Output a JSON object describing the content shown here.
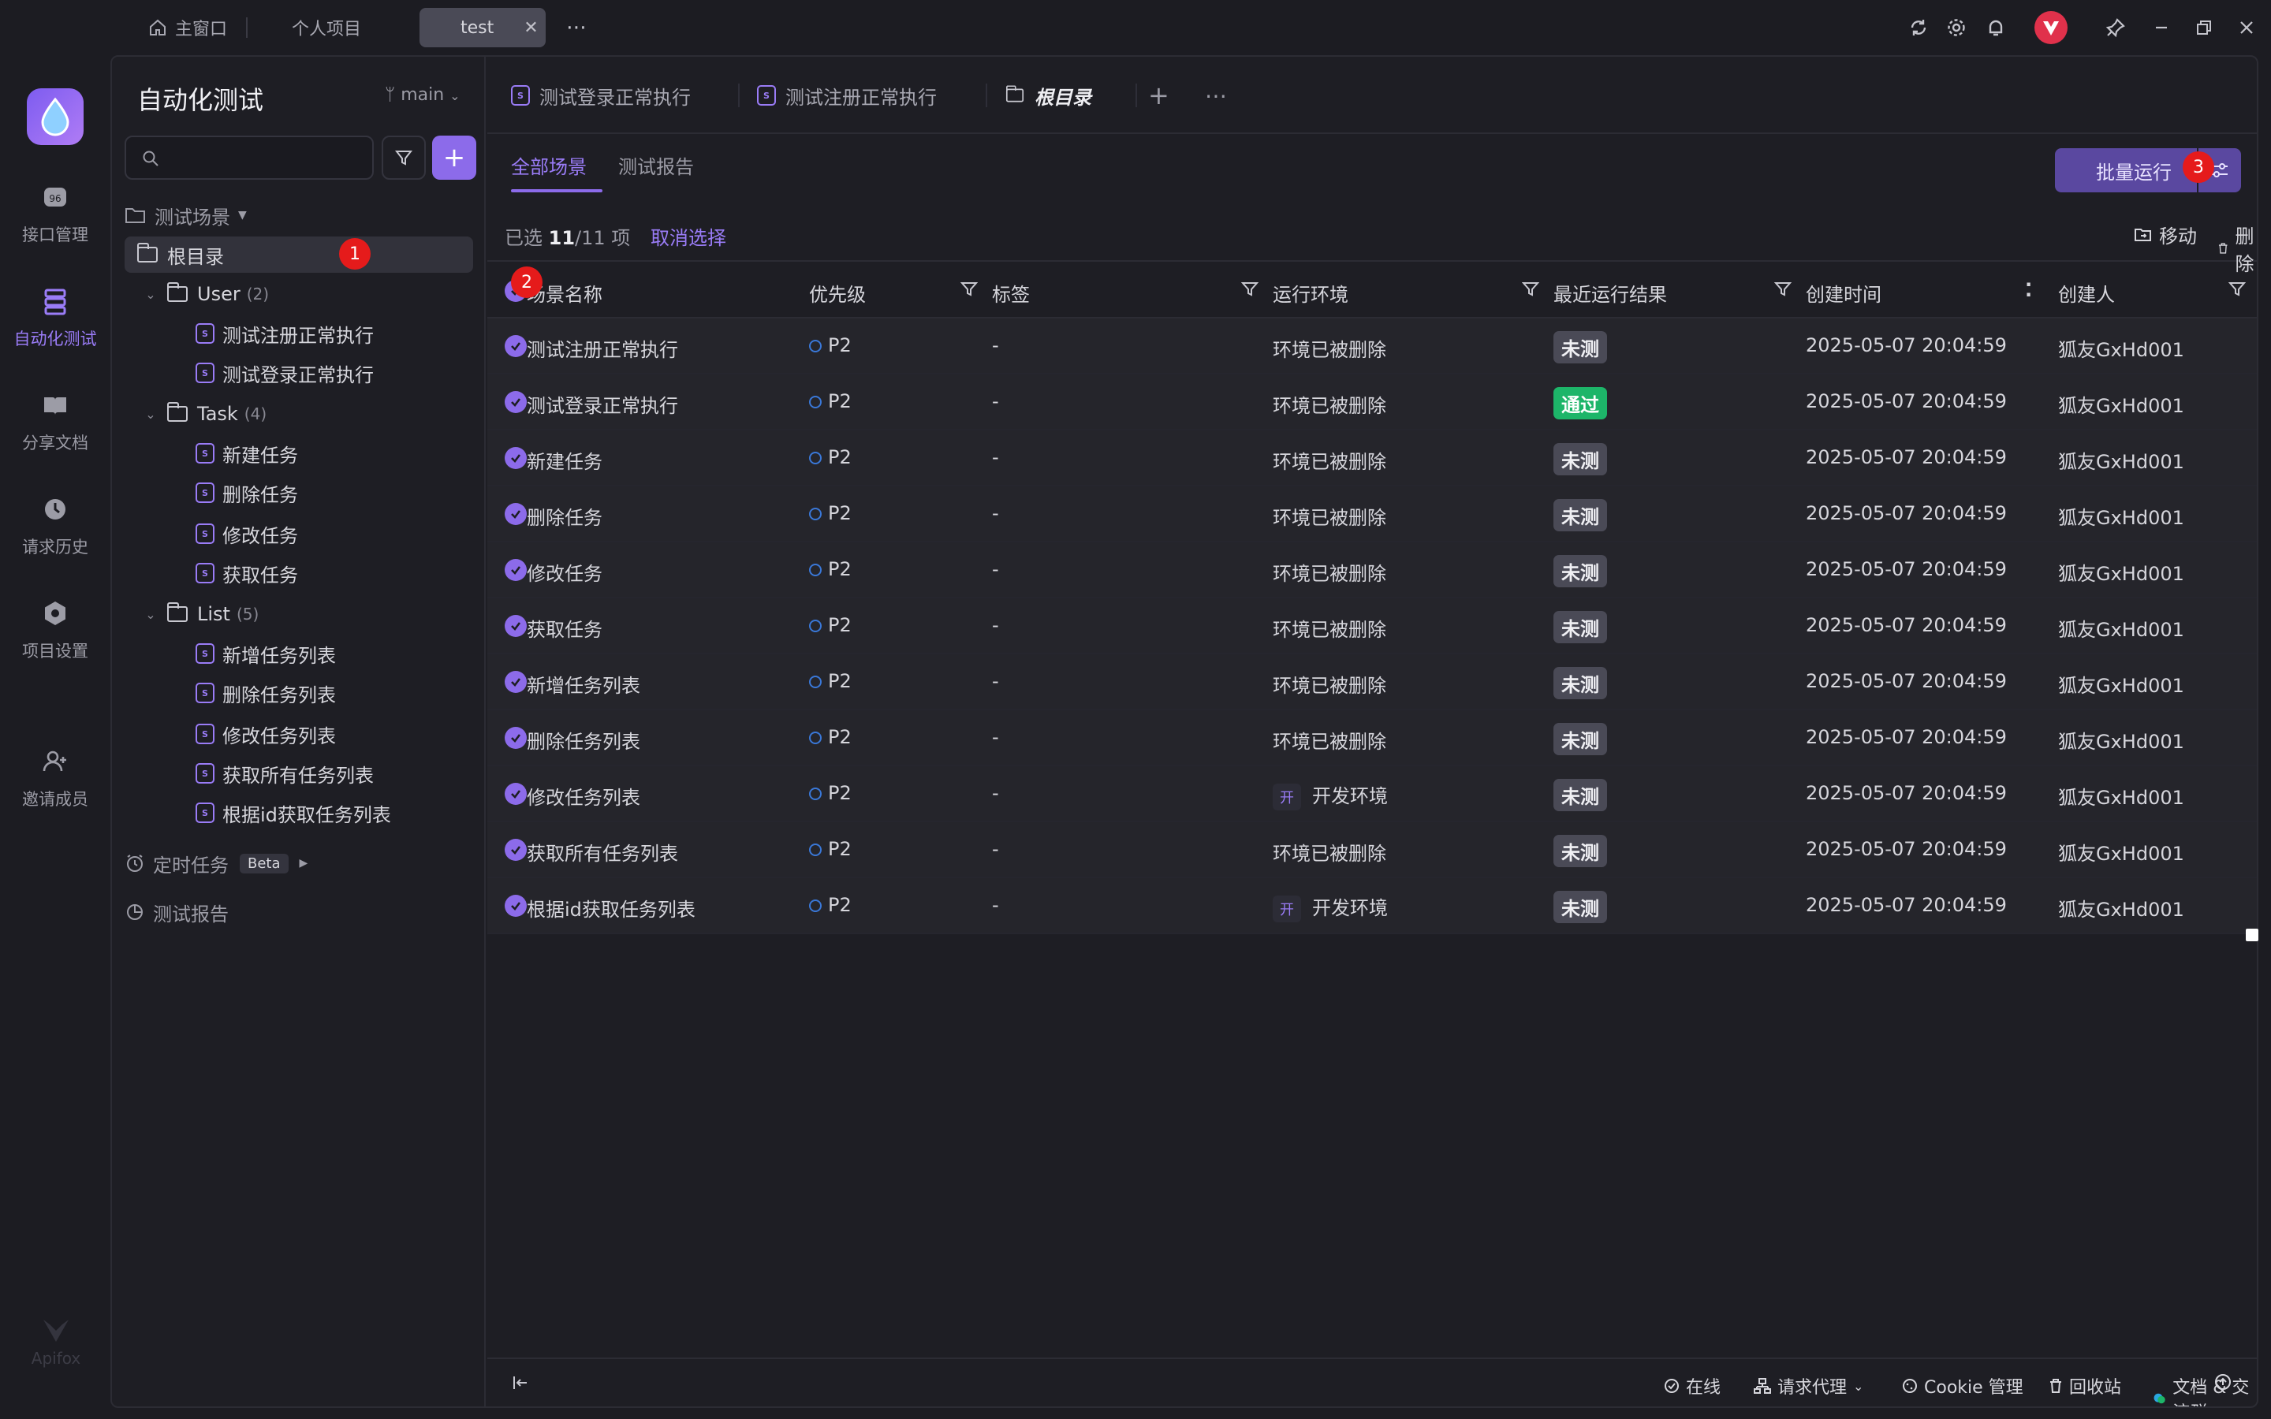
{
  "window": {
    "tabs": [
      {
        "label": "主窗口"
      },
      {
        "label": "个人项目"
      },
      {
        "label": "test"
      }
    ]
  },
  "rail": {
    "items": [
      {
        "label": "接口管理"
      },
      {
        "label": "自动化测试"
      },
      {
        "label": "分享文档"
      },
      {
        "label": "请求历史"
      },
      {
        "label": "项目设置"
      },
      {
        "label": "邀请成员"
      }
    ],
    "footer": "Apifox"
  },
  "sidebar": {
    "title": "自动化测试",
    "branch": "main",
    "section_label": "测试场景",
    "tree": [
      {
        "label": "根目录",
        "count": ""
      },
      {
        "label": "User",
        "count": "(2)"
      },
      {
        "label": "测试注册正常执行"
      },
      {
        "label": "测试登录正常执行"
      },
      {
        "label": "Task",
        "count": "(4)"
      },
      {
        "label": "新建任务"
      },
      {
        "label": "删除任务"
      },
      {
        "label": "修改任务"
      },
      {
        "label": "获取任务"
      },
      {
        "label": "List",
        "count": "(5)"
      },
      {
        "label": "新增任务列表"
      },
      {
        "label": "删除任务列表"
      },
      {
        "label": "修改任务列表"
      },
      {
        "label": "获取所有任务列表"
      },
      {
        "label": "根据id获取任务列表"
      }
    ],
    "scheduled": "定时任务",
    "beta": "Beta",
    "reports": "测试报告"
  },
  "markers": [
    "1",
    "2",
    "3"
  ],
  "content": {
    "tabs": [
      {
        "label": "测试登录正常执行"
      },
      {
        "label": "测试注册正常执行"
      },
      {
        "label": "根目录"
      }
    ],
    "subtabs": [
      {
        "label": "全部场景"
      },
      {
        "label": "测试报告"
      }
    ],
    "batch_run": "批量运行",
    "selection": {
      "prefix": "已选",
      "count": "11",
      "total": "/11 项",
      "cancel": "取消选择",
      "move": "移动",
      "delete": "删除"
    },
    "columns": [
      "场景名称",
      "优先级",
      "标签",
      "运行环境",
      "最近运行结果",
      "创建时间",
      "创建人"
    ],
    "rows": [
      {
        "name": "测试注册正常执行",
        "priority": "P2",
        "tag": "-",
        "env": "环境已被删除",
        "env_tag": "",
        "result": "未测",
        "status": "untested",
        "created": "2025-05-07 20:04:59",
        "creator": "狐友GxHd001"
      },
      {
        "name": "测试登录正常执行",
        "priority": "P2",
        "tag": "-",
        "env": "环境已被删除",
        "env_tag": "",
        "result": "通过",
        "status": "pass",
        "created": "2025-05-07 20:04:59",
        "creator": "狐友GxHd001"
      },
      {
        "name": "新建任务",
        "priority": "P2",
        "tag": "-",
        "env": "环境已被删除",
        "env_tag": "",
        "result": "未测",
        "status": "untested",
        "created": "2025-05-07 20:04:59",
        "creator": "狐友GxHd001"
      },
      {
        "name": "删除任务",
        "priority": "P2",
        "tag": "-",
        "env": "环境已被删除",
        "env_tag": "",
        "result": "未测",
        "status": "untested",
        "created": "2025-05-07 20:04:59",
        "creator": "狐友GxHd001"
      },
      {
        "name": "修改任务",
        "priority": "P2",
        "tag": "-",
        "env": "环境已被删除",
        "env_tag": "",
        "result": "未测",
        "status": "untested",
        "created": "2025-05-07 20:04:59",
        "creator": "狐友GxHd001"
      },
      {
        "name": "获取任务",
        "priority": "P2",
        "tag": "-",
        "env": "环境已被删除",
        "env_tag": "",
        "result": "未测",
        "status": "untested",
        "created": "2025-05-07 20:04:59",
        "creator": "狐友GxHd001"
      },
      {
        "name": "新增任务列表",
        "priority": "P2",
        "tag": "-",
        "env": "环境已被删除",
        "env_tag": "",
        "result": "未测",
        "status": "untested",
        "created": "2025-05-07 20:04:59",
        "creator": "狐友GxHd001"
      },
      {
        "name": "删除任务列表",
        "priority": "P2",
        "tag": "-",
        "env": "环境已被删除",
        "env_tag": "",
        "result": "未测",
        "status": "untested",
        "created": "2025-05-07 20:04:59",
        "creator": "狐友GxHd001"
      },
      {
        "name": "修改任务列表",
        "priority": "P2",
        "tag": "-",
        "env": "开发环境",
        "env_tag": "开",
        "result": "未测",
        "status": "untested",
        "created": "2025-05-07 20:04:59",
        "creator": "狐友GxHd001"
      },
      {
        "name": "获取所有任务列表",
        "priority": "P2",
        "tag": "-",
        "env": "环境已被删除",
        "env_tag": "",
        "result": "未测",
        "status": "untested",
        "created": "2025-05-07 20:04:59",
        "creator": "狐友GxHd001"
      },
      {
        "name": "根据id获取任务列表",
        "priority": "P2",
        "tag": "-",
        "env": "开发环境",
        "env_tag": "开",
        "result": "未测",
        "status": "untested",
        "created": "2025-05-07 20:04:59",
        "creator": "狐友GxHd001"
      }
    ]
  },
  "footer": {
    "online": "在线",
    "proxy": "请求代理",
    "cookie": "Cookie 管理",
    "trash": "回收站",
    "docs": "文档 & 交流群"
  },
  "colors": {
    "accent": "#8c6bea",
    "pass": "#1db569",
    "marker": "#e51b1b"
  }
}
